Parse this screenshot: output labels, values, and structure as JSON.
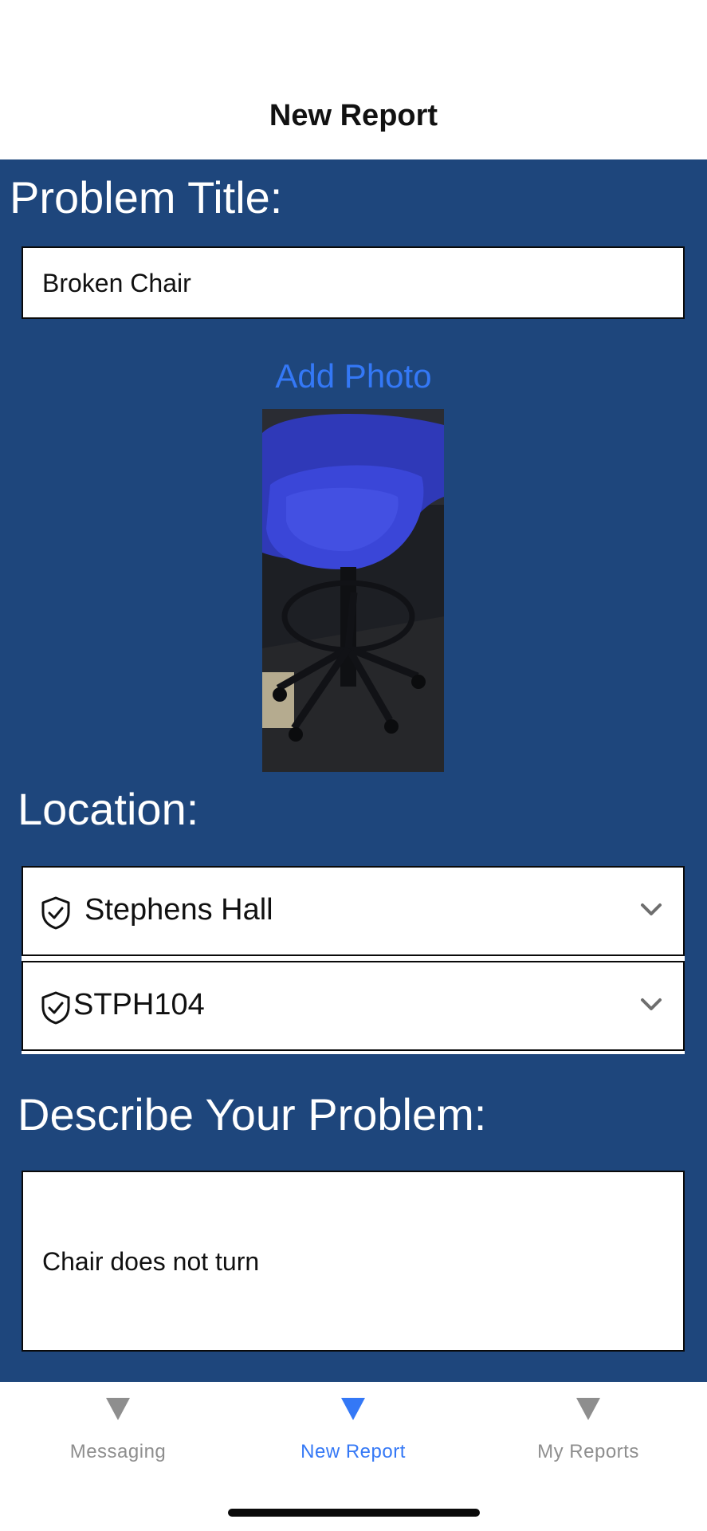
{
  "header": {
    "title": "New Report"
  },
  "form": {
    "problem_title_label": "Problem Title:",
    "problem_title_value": "Broken Chair",
    "add_photo_label": "Add Photo",
    "location_label": "Location:",
    "building_value": "Stephens Hall",
    "room_value": "STPH104",
    "describe_label": "Describe Your Problem:",
    "description_value": "Chair does not turn"
  },
  "tabbar": {
    "tabs": [
      {
        "label": "Messaging",
        "icon": "triangle-down-icon",
        "active": false
      },
      {
        "label": "New Report",
        "icon": "triangle-down-icon",
        "active": true
      },
      {
        "label": "My Reports",
        "icon": "triangle-down-icon",
        "active": false
      }
    ]
  },
  "colors": {
    "main_background": "#1e467c",
    "accent_blue": "#3478f6",
    "inactive_gray": "#8e8e8e",
    "field_border": "#0a0a0a"
  }
}
